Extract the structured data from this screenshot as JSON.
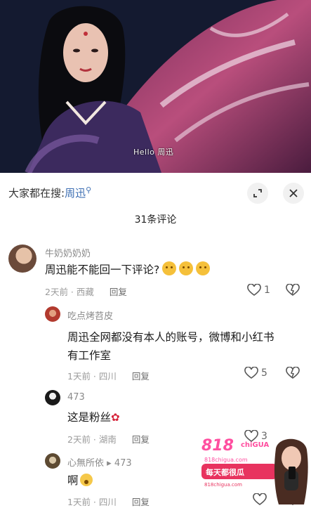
{
  "video": {
    "watermark": "Hello 周迅"
  },
  "sheet": {
    "search_prefix": "大家都在搜:",
    "search_keyword": "周迅",
    "comment_count": "31条评论",
    "buttons": {
      "expand_icon": "expand-icon",
      "close_icon": "close-icon"
    }
  },
  "comments": [
    {
      "username": "牛奶奶奶奶",
      "text": "周迅能不能回一下评论?",
      "time": "2天前",
      "location": "西藏",
      "reply_label": "回复",
      "likes": "1"
    },
    {
      "username": "吃点烤苕皮",
      "text_line1": "周迅全网都没有本人的账号，微博和小红书",
      "text_line2": "有工作室",
      "time": "1天前",
      "location": "四川",
      "reply_label": "回复",
      "likes": "5"
    },
    {
      "username": "473",
      "text": "这是粉丝",
      "time": "2天前",
      "location": "湖南",
      "reply_label": "回复",
      "likes": "3"
    },
    {
      "username": "心無所依",
      "reply_to": "473",
      "text": "啊",
      "time": "1天前",
      "location": "四川",
      "reply_label": "回复"
    }
  ],
  "ad": {
    "brand": "818",
    "brand_tag": "chiGUA",
    "site": "818chigua.com",
    "banner": "每天都很瓜",
    "fine_print": "818chigua.com"
  },
  "colors": {
    "link_blue": "#3e6fb3",
    "meta_gray": "#9a9a9a",
    "ad_pink": "#e8335f"
  }
}
